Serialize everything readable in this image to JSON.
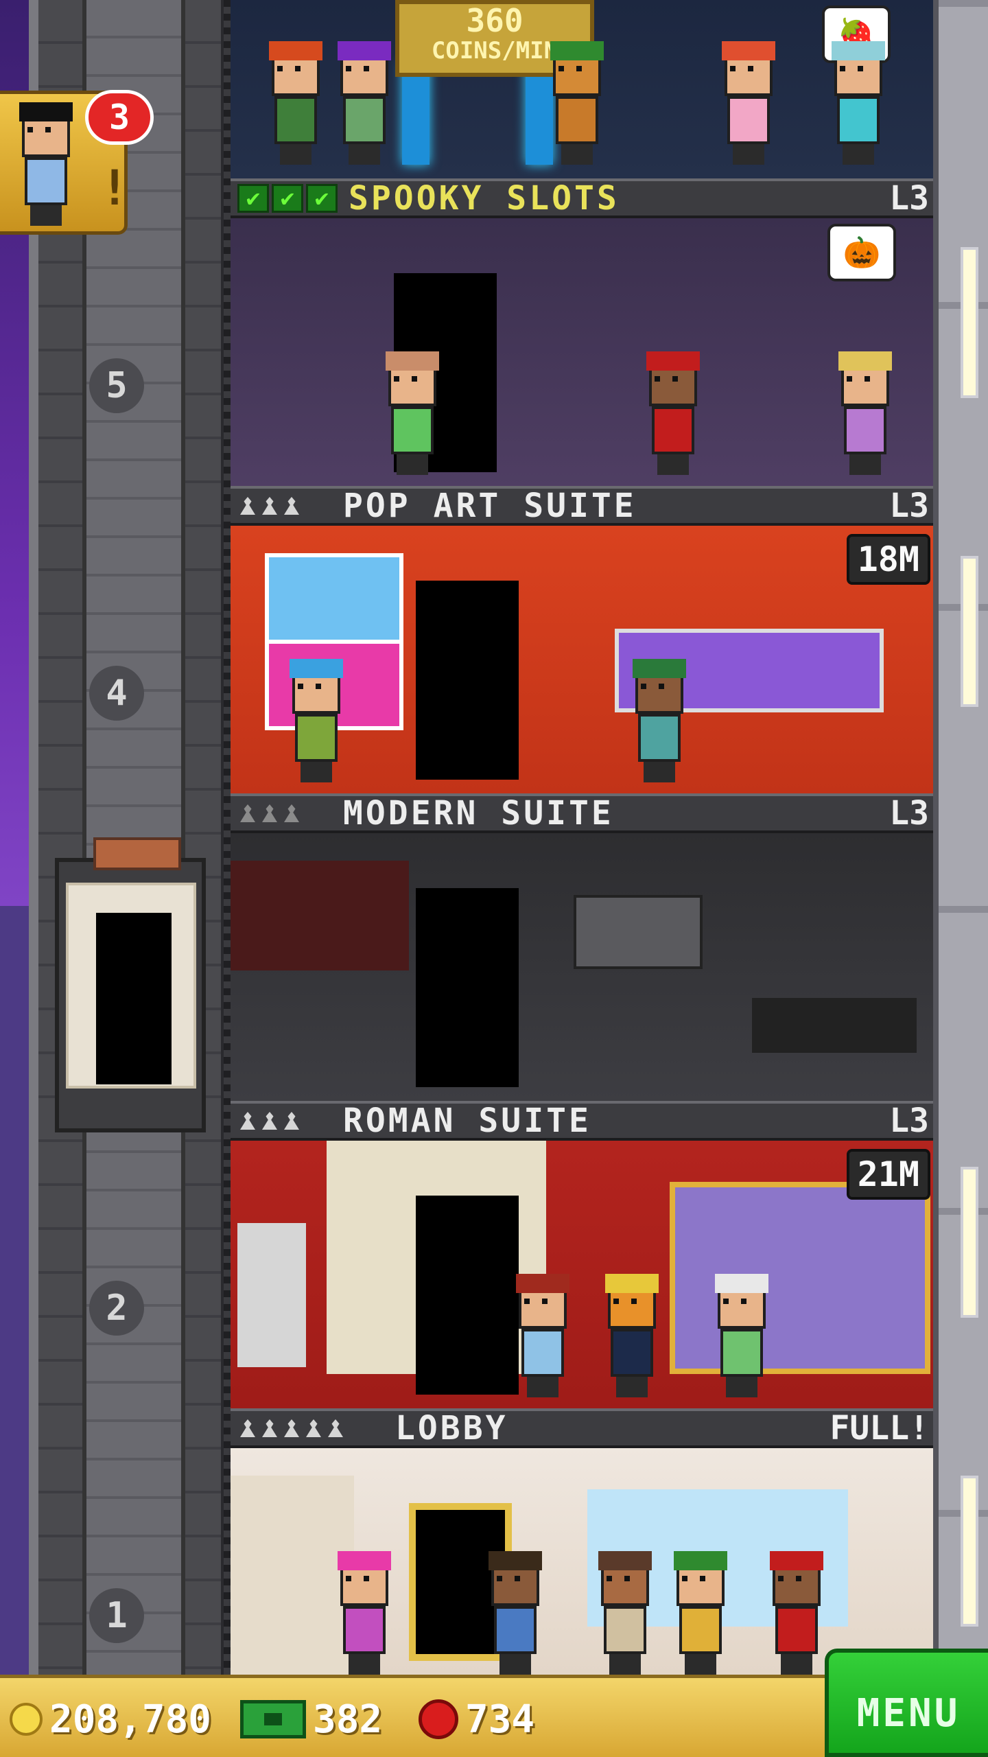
{
  "top_floor": {
    "coins_value": "360",
    "coins_unit": "COINS/MIN"
  },
  "notification": {
    "count": "3"
  },
  "floors": [
    {
      "name": "SPOOKY SLOTS",
      "level": "L3",
      "badge": ""
    },
    {
      "name": "POP ART SUITE",
      "level": "L3",
      "badge": "18M"
    },
    {
      "name": "MODERN SUITE",
      "level": "L3",
      "badge": ""
    },
    {
      "name": "ROMAN SUITE",
      "level": "L3",
      "badge": "21M"
    },
    {
      "name": "LOBBY",
      "level": "FULL!",
      "badge": ""
    }
  ],
  "shaft_floor_numbers": [
    "5",
    "4",
    "2",
    "1"
  ],
  "bottom_bar": {
    "coins": "208,780",
    "bux": "382",
    "gems": "734",
    "menu_label": "MENU"
  },
  "colors": {
    "accent_gold": "#d8a733",
    "menu_green": "#14a51c",
    "header_gray": "#3c3c40"
  }
}
